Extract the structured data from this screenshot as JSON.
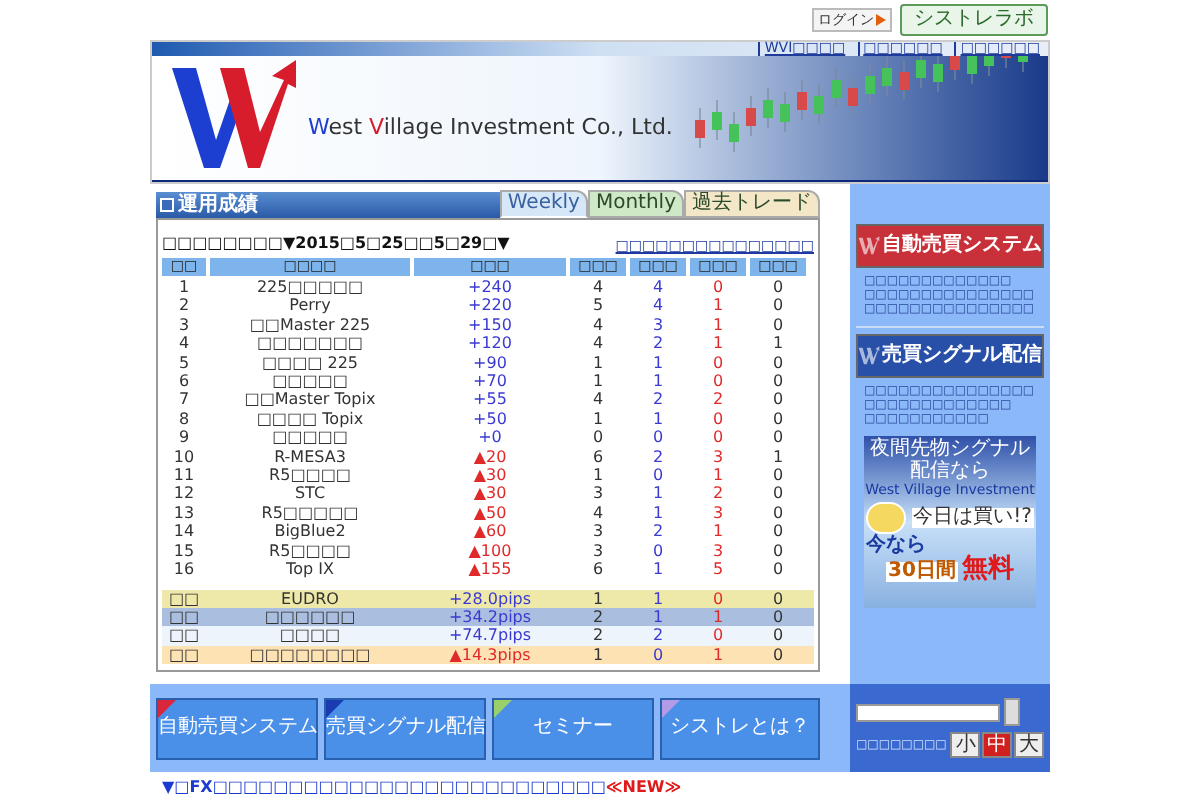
{
  "top_bar": {
    "login": "ログイン",
    "lab_button": "シストレラボ"
  },
  "header": {
    "company_name": [
      {
        "text": "W",
        "accent": true
      },
      {
        "text": "est ",
        "accent": false
      },
      {
        "text": "V",
        "accent": true
      },
      {
        "text": "illage Investment Co., Ltd.",
        "accent": false
      }
    ],
    "nav_links": [
      "WVI□□□□",
      "□□□□□□",
      "□□□□□□"
    ]
  },
  "panel": {
    "title": "運用成績",
    "tabs": [
      {
        "label": "Weekly",
        "selected": true,
        "color": "#d6e8f7"
      },
      {
        "label": "Monthly",
        "selected": false,
        "color": "#cfe8c6"
      },
      {
        "label": "過去トレード",
        "selected": false,
        "color": "#f3e7c8"
      }
    ],
    "period": "□□□□□□□□▼2015□5□25□□5□29□▼",
    "link": "□□□□□□□□□□□□□□□",
    "columns": [
      "□□",
      "□□□□",
      "□□□",
      "□□□",
      "□□□",
      "□□□",
      "□□□"
    ],
    "rows": [
      {
        "no": "1",
        "name": "225□□□□□",
        "pips": "+240",
        "kind": "gain",
        "c4": "4",
        "c5": "4",
        "c6": "0",
        "c7": "0"
      },
      {
        "no": "2",
        "name": "Perry",
        "pips": "+220",
        "kind": "gain",
        "c4": "5",
        "c5": "4",
        "c6": "1",
        "c7": "0"
      },
      {
        "no": "3",
        "name": "□□Master 225",
        "pips": "+150",
        "kind": "gain",
        "c4": "4",
        "c5": "3",
        "c6": "1",
        "c7": "0"
      },
      {
        "no": "4",
        "name": "□□□□□□□",
        "pips": "+120",
        "kind": "gain",
        "c4": "4",
        "c5": "2",
        "c6": "1",
        "c7": "1"
      },
      {
        "no": "5",
        "name": "□□□□ 225",
        "pips": "+90",
        "kind": "gain",
        "c4": "1",
        "c5": "1",
        "c6": "0",
        "c7": "0"
      },
      {
        "no": "6",
        "name": "□□□□□",
        "pips": "+70",
        "kind": "gain",
        "c4": "1",
        "c5": "1",
        "c6": "0",
        "c7": "0"
      },
      {
        "no": "7",
        "name": "□□Master Topix",
        "pips": "+55",
        "kind": "gain",
        "c4": "4",
        "c5": "2",
        "c6": "2",
        "c7": "0"
      },
      {
        "no": "8",
        "name": "□□□□ Topix",
        "pips": "+50",
        "kind": "gain",
        "c4": "1",
        "c5": "1",
        "c6": "0",
        "c7": "0"
      },
      {
        "no": "9",
        "name": "□□□□□",
        "pips": "+0",
        "kind": "gain",
        "c4": "0",
        "c5": "0",
        "c6": "0",
        "c7": "0"
      },
      {
        "no": "10",
        "name": "R-MESA3",
        "pips": "▲20",
        "kind": "loss",
        "c4": "6",
        "c5": "2",
        "c6": "3",
        "c7": "1"
      },
      {
        "no": "11",
        "name": "R5□□□□",
        "pips": "▲30",
        "kind": "loss",
        "c4": "1",
        "c5": "0",
        "c6": "1",
        "c7": "0"
      },
      {
        "no": "12",
        "name": "STC",
        "pips": "▲30",
        "kind": "loss",
        "c4": "3",
        "c5": "1",
        "c6": "2",
        "c7": "0"
      },
      {
        "no": "13",
        "name": "R5□□□□□",
        "pips": "▲50",
        "kind": "loss",
        "c4": "4",
        "c5": "1",
        "c6": "3",
        "c7": "0"
      },
      {
        "no": "14",
        "name": "BigBlue2",
        "pips": "▲60",
        "kind": "loss",
        "c4": "3",
        "c5": "2",
        "c6": "1",
        "c7": "0"
      },
      {
        "no": "15",
        "name": "R5□□□□",
        "pips": "▲100",
        "kind": "loss",
        "c4": "3",
        "c5": "0",
        "c6": "3",
        "c7": "0"
      },
      {
        "no": "16",
        "name": "Top IX",
        "pips": "▲155",
        "kind": "loss",
        "c4": "6",
        "c5": "1",
        "c6": "5",
        "c7": "0"
      }
    ],
    "summary_rows": [
      {
        "no": "□□",
        "name": "EUDRO",
        "pips": "+28.0pips",
        "kind": "gain",
        "c4": "1",
        "c5": "1",
        "c6": "0",
        "c7": "0",
        "color": "#efe9a9"
      },
      {
        "no": "□□",
        "name": "□□□□□□",
        "pips": "+34.2pips",
        "kind": "gain",
        "c4": "2",
        "c5": "1",
        "c6": "1",
        "c7": "0",
        "color": "#aabfe0"
      },
      {
        "no": "□□",
        "name": "□□□□",
        "pips": "+74.7pips",
        "kind": "gain",
        "c4": "2",
        "c5": "2",
        "c6": "0",
        "c7": "0",
        "color": "#eef4fb"
      },
      {
        "no": "□□",
        "name": "□□□□□□□□",
        "pips": "▲14.3pips",
        "kind": "loss",
        "c4": "1",
        "c5": "0",
        "c6": "1",
        "c7": "0",
        "color": "#fde2b4"
      }
    ]
  },
  "sidebar": {
    "blocks": [
      {
        "banner": "自動売買システム",
        "kind": "red",
        "lines": [
          "□□□□□□□□□□□□□",
          "□□□□□□□□□□□□□□□",
          "□□□□□□□□□□□□□□□"
        ]
      },
      {
        "banner": "売買シグナル配信",
        "kind": "blue",
        "lines": [
          "□□□□□□□□□□□□□□□",
          "□□□□□□□□□□□□□",
          "□□□□□□□□□□□"
        ]
      }
    ],
    "ad": {
      "headline": "夜間先物シグナル配信なら",
      "brand": "West Village Investment",
      "bubble": "今日は買い!?",
      "now": "今なら",
      "days": "30日間",
      "free": "無料"
    }
  },
  "bottom_nav": [
    {
      "label": "自動売買システム",
      "color": "#d9263a"
    },
    {
      "label": "売買シグナル配信",
      "color": "#1a3cb0"
    },
    {
      "label": "セミナー",
      "color": "#9ad06a"
    },
    {
      "label": "シストレとは？",
      "color": "#b49be8"
    }
  ],
  "font_size": {
    "label": "□□□□□□□□",
    "options": [
      {
        "label": "小",
        "selected": false
      },
      {
        "label": "中",
        "selected": true
      },
      {
        "label": "大",
        "selected": false
      }
    ]
  },
  "news": {
    "marker": "▼□",
    "title": "FX□□□□□□□□□□□□□□□□□□□□□□□□□□",
    "badge": "≪NEW≫"
  }
}
